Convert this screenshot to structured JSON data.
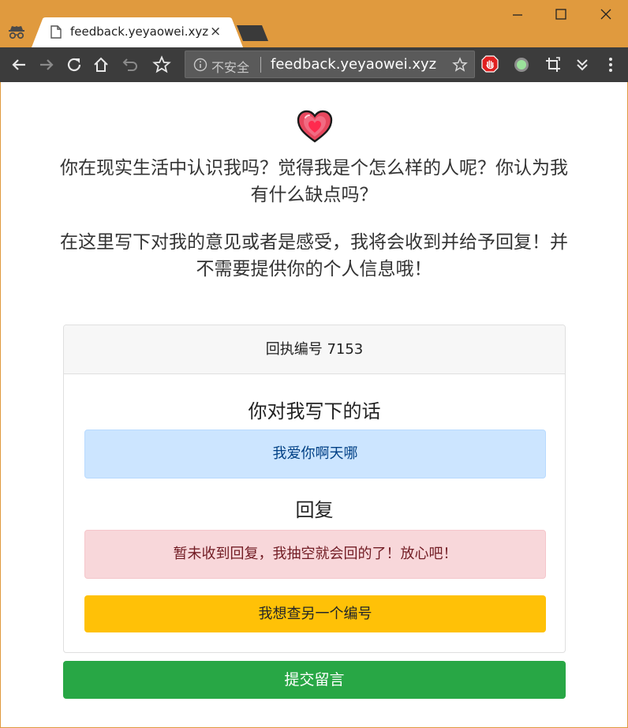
{
  "browser": {
    "tab_title": "feedback.yeyaowei.xyz",
    "tab_close": "×",
    "security_label": "不安全",
    "url": "feedback.yeyaowei.xyz"
  },
  "page": {
    "intro_question": "你在现实生活中认识我吗？觉得我是个怎么样的人呢？你认为我有什么缺点吗？",
    "intro_instruction": "在这里写下对我的意见或者是感受，我将会收到并给予回复！并不需要提供你的个人信息哦！",
    "receipt": {
      "label": "回执编号",
      "number": "7153"
    },
    "message_title": "你对我写下的话",
    "message_text": "我爱你啊天哪",
    "reply_title": "回复",
    "reply_text": "暂未收到回复，我抽空就会回的了！放心吧！",
    "lookup_button": "我想查另一个编号",
    "submit_button": "提交留言"
  },
  "colors": {
    "titlebar": "#e09a3e",
    "toolbar": "#3c3c3c",
    "info_alert_bg": "#cce5ff",
    "danger_alert_bg": "#f8d7da",
    "warning_button": "#ffc107",
    "success_button": "#28a745"
  }
}
